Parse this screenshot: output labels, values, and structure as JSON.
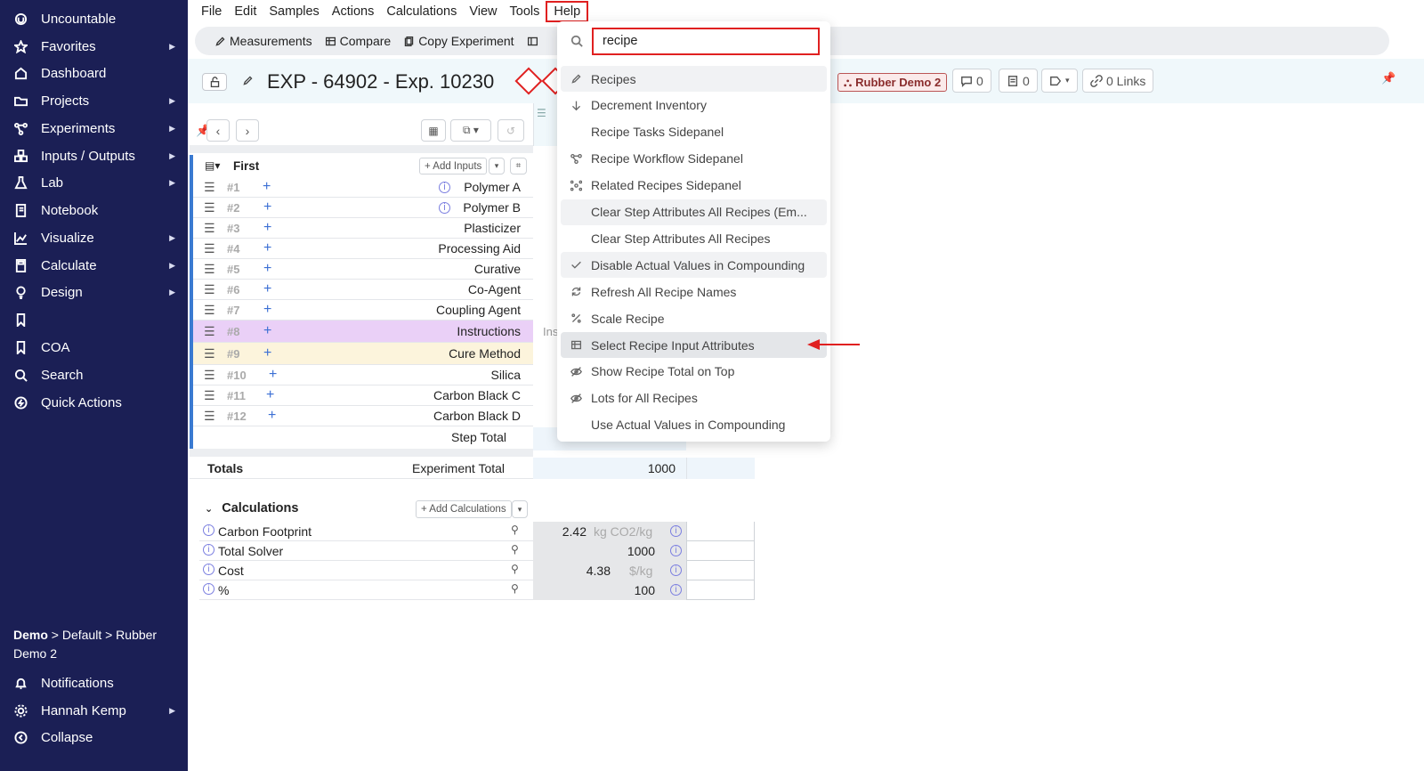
{
  "sidebar": {
    "items": [
      {
        "label": "Uncountable",
        "icon": "logo-icon",
        "caret": false
      },
      {
        "label": "Favorites",
        "icon": "star-icon",
        "caret": true
      },
      {
        "label": "Dashboard",
        "icon": "home-icon",
        "caret": false
      },
      {
        "label": "Projects",
        "icon": "folder-icon",
        "caret": true
      },
      {
        "label": "Experiments",
        "icon": "network-icon",
        "caret": true
      },
      {
        "label": "Inputs / Outputs",
        "icon": "cubes-icon",
        "caret": true
      },
      {
        "label": "Lab",
        "icon": "flask-icon",
        "caret": true
      },
      {
        "label": "Notebook",
        "icon": "notebook-icon",
        "caret": false
      },
      {
        "label": "Visualize",
        "icon": "chart-icon",
        "caret": true
      },
      {
        "label": "Calculate",
        "icon": "calculator-icon",
        "caret": true
      },
      {
        "label": "Design",
        "icon": "bulb-icon",
        "caret": true
      },
      {
        "label": "",
        "icon": "bookmark-icon",
        "caret": false
      },
      {
        "label": "COA",
        "icon": "bookmark-icon",
        "caret": false
      },
      {
        "label": "Search",
        "icon": "search-icon",
        "caret": false
      },
      {
        "label": "Quick Actions",
        "icon": "bolt-icon",
        "caret": false
      }
    ],
    "breadcrumb_bold": "Demo",
    "breadcrumb_rest": " > Default > Rubber Demo 2",
    "bottom": [
      {
        "label": "Notifications",
        "icon": "bell-icon",
        "caret": false
      },
      {
        "label": "Hannah Kemp",
        "icon": "gear-icon",
        "caret": true
      },
      {
        "label": "Collapse",
        "icon": "collapse-icon",
        "caret": false
      }
    ]
  },
  "menubar": [
    "File",
    "Edit",
    "Samples",
    "Actions",
    "Calculations",
    "View",
    "Tools",
    "Help"
  ],
  "toolbar": {
    "measurements": "Measurements",
    "compare": "Compare",
    "copy_experiment": "Copy Experiment"
  },
  "header": {
    "title": "EXP - 64902 - Exp. 10230",
    "project_badge": "Rubber Demo 2",
    "comments_count": "0",
    "notes_count": "0",
    "links": "0 Links"
  },
  "step": {
    "name": "First",
    "add_inputs": "+ Add Inputs",
    "rows": [
      {
        "num": "#1",
        "name": "Polymer A",
        "info": true,
        "style": ""
      },
      {
        "num": "#2",
        "name": "Polymer B",
        "info": true,
        "style": ""
      },
      {
        "num": "#3",
        "name": "Plasticizer",
        "info": false,
        "style": ""
      },
      {
        "num": "#4",
        "name": "Processing Aid",
        "info": false,
        "style": ""
      },
      {
        "num": "#5",
        "name": "Curative",
        "info": false,
        "style": ""
      },
      {
        "num": "#6",
        "name": "Co-Agent",
        "info": false,
        "style": ""
      },
      {
        "num": "#7",
        "name": "Coupling Agent",
        "info": false,
        "style": ""
      },
      {
        "num": "#8",
        "name": "Instructions",
        "info": false,
        "style": "instr"
      },
      {
        "num": "#9",
        "name": "Cure Method",
        "info": false,
        "style": "cure"
      },
      {
        "num": "#10",
        "name": "Silica",
        "info": false,
        "style": ""
      },
      {
        "num": "#11",
        "name": "Carbon Black C",
        "info": false,
        "style": ""
      },
      {
        "num": "#12",
        "name": "Carbon Black D",
        "info": false,
        "style": ""
      }
    ],
    "step_total_label": "Step Total",
    "instr_peek": "Ins"
  },
  "totals": {
    "label": "Totals",
    "experiment_total_label": "Experiment Total",
    "experiment_total_value": "1000"
  },
  "calculations": {
    "header": "Calculations",
    "add_label": "+ Add Calculations",
    "rows": [
      {
        "label": "Carbon Footprint",
        "value": "2.42",
        "unit": "kg CO2/kg"
      },
      {
        "label": "Total Solver",
        "value": "1000",
        "unit": ""
      },
      {
        "label": "Cost",
        "value": "4.38",
        "unit": "$/kg"
      },
      {
        "label": "%",
        "value": "100",
        "unit": ""
      }
    ]
  },
  "help_menu": {
    "search_value": "recipe",
    "items": [
      {
        "label": "Recipes",
        "icon": "pencil-icon",
        "state": "hl"
      },
      {
        "label": "Decrement Inventory",
        "icon": "arrow-down-icon",
        "state": ""
      },
      {
        "label": "Recipe Tasks Sidepanel",
        "icon": "",
        "state": ""
      },
      {
        "label": "Recipe Workflow Sidepanel",
        "icon": "workflow-icon",
        "state": ""
      },
      {
        "label": "Related Recipes Sidepanel",
        "icon": "related-icon",
        "state": ""
      },
      {
        "label": "Clear Step Attributes All Recipes (Em...",
        "icon": "",
        "state": "hl"
      },
      {
        "label": "Clear Step Attributes All Recipes",
        "icon": "",
        "state": ""
      },
      {
        "label": "Disable Actual Values in Compounding",
        "icon": "check-icon",
        "state": "hl"
      },
      {
        "label": "Refresh All Recipe Names",
        "icon": "refresh-icon",
        "state": ""
      },
      {
        "label": "Scale Recipe",
        "icon": "percent-icon",
        "state": ""
      },
      {
        "label": "Select Recipe Input Attributes",
        "icon": "table-icon",
        "state": "sel"
      },
      {
        "label": "Show Recipe Total on Top",
        "icon": "eye-off-icon",
        "state": ""
      },
      {
        "label": "Lots for All Recipes",
        "icon": "eye-off-icon",
        "state": ""
      },
      {
        "label": "Use Actual Values in Compounding",
        "icon": "",
        "state": ""
      }
    ]
  },
  "colors": {
    "sidebar_bg": "#1b1f55",
    "highlight_red": "#e02020",
    "accent_blue": "#3b6fd4"
  }
}
